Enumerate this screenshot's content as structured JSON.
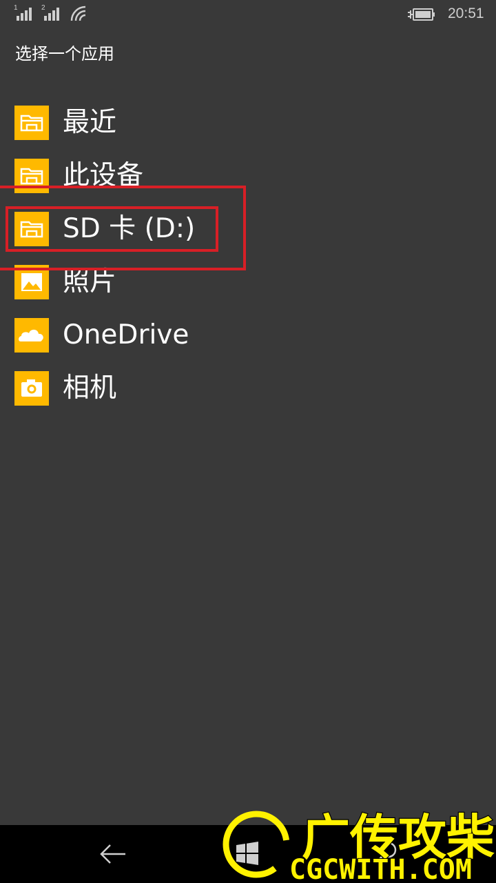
{
  "status_bar": {
    "sim1_label": "1",
    "sim2_label": "2",
    "time": "20:51",
    "icons": [
      "signal-icon",
      "signal-icon",
      "wifi-icon",
      "battery-charging-icon"
    ]
  },
  "page": {
    "title": "选择一个应用"
  },
  "apps": [
    {
      "label": "最近",
      "icon": "folder-icon"
    },
    {
      "label": "此设备",
      "icon": "folder-icon"
    },
    {
      "label": "SD 卡 (D:)",
      "icon": "folder-icon"
    },
    {
      "label": "照片",
      "icon": "photos-icon"
    },
    {
      "label": "OneDrive",
      "icon": "onedrive-icon"
    },
    {
      "label": "相机",
      "icon": "camera-icon"
    }
  ],
  "nav_bar": {
    "icons": [
      "back-arrow-icon",
      "windows-start-icon",
      "search-icon"
    ]
  },
  "watermark": {
    "title": "广传攻柴",
    "url": "CGCWITH.COM"
  },
  "colors": {
    "background": "#393939",
    "tile_accent": "#ffb900",
    "highlight_red": "#d81f26",
    "nav_bar": "#000000",
    "watermark_yellow": "#fff200"
  }
}
